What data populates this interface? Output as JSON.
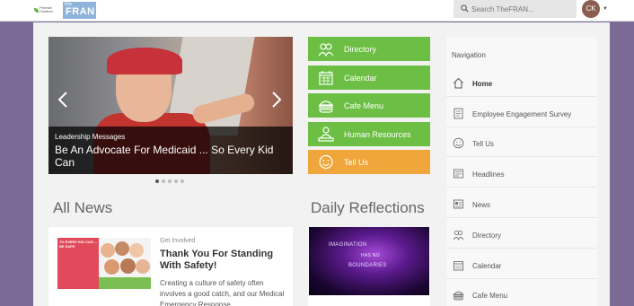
{
  "header": {
    "logo_org_text": "Premier Children",
    "logo_the": "the",
    "logo_brand": "FRAN",
    "search_placeholder": "Search TheFRAN...",
    "avatar_initials": "CK"
  },
  "carousel": {
    "kicker": "Leadership Messages",
    "title": "Be An Advocate For Medicaid ... So Every Kid Can",
    "dots_count": 5,
    "active_dot": 0
  },
  "tiles": [
    {
      "label": "Directory",
      "icon": "directory-icon",
      "color": "#6cbf44"
    },
    {
      "label": "Calendar",
      "icon": "calendar-icon",
      "color": "#6cbf44"
    },
    {
      "label": "Cafe Menu",
      "icon": "cafe-menu-icon",
      "color": "#6cbf44"
    },
    {
      "label": "Human Resources",
      "icon": "human-resources-icon",
      "color": "#6cbf44"
    },
    {
      "label": "Tell Us",
      "icon": "smiley-icon",
      "color": "#f0a63a"
    }
  ],
  "all_news": {
    "heading": "All News",
    "card": {
      "image_text": "TO EVERY KID CAN ... BE SAFE",
      "category": "Get Involved",
      "title": "Thank You For Standing With Safety!",
      "body": "Creating a culture of safety often involves a good catch, and our Medical Emergency Response"
    }
  },
  "daily_reflections": {
    "heading": "Daily Reflections",
    "image_words": [
      "IMAGINATION",
      "HAS NO",
      "BOUNDARIES"
    ]
  },
  "navigation": {
    "heading": "Navigation",
    "items": [
      {
        "label": "Home",
        "icon": "home-icon",
        "active": true
      },
      {
        "label": "Employee Engagement Survey",
        "icon": "survey-icon",
        "active": false
      },
      {
        "label": "Tell Us",
        "icon": "smiley-icon",
        "active": false
      },
      {
        "label": "Headlines",
        "icon": "headlines-icon",
        "active": false
      },
      {
        "label": "News",
        "icon": "news-icon",
        "active": false
      },
      {
        "label": "Directory",
        "icon": "directory-icon",
        "active": false
      },
      {
        "label": "Calendar",
        "icon": "calendar-icon",
        "active": false
      },
      {
        "label": "Cafe Menu",
        "icon": "cafe-menu-icon",
        "active": false
      }
    ]
  },
  "colors": {
    "page_bg": "#7b6a96",
    "tile_green": "#6cbf44",
    "tile_orange": "#f0a63a",
    "brand_blue": "#8fb4d9"
  }
}
